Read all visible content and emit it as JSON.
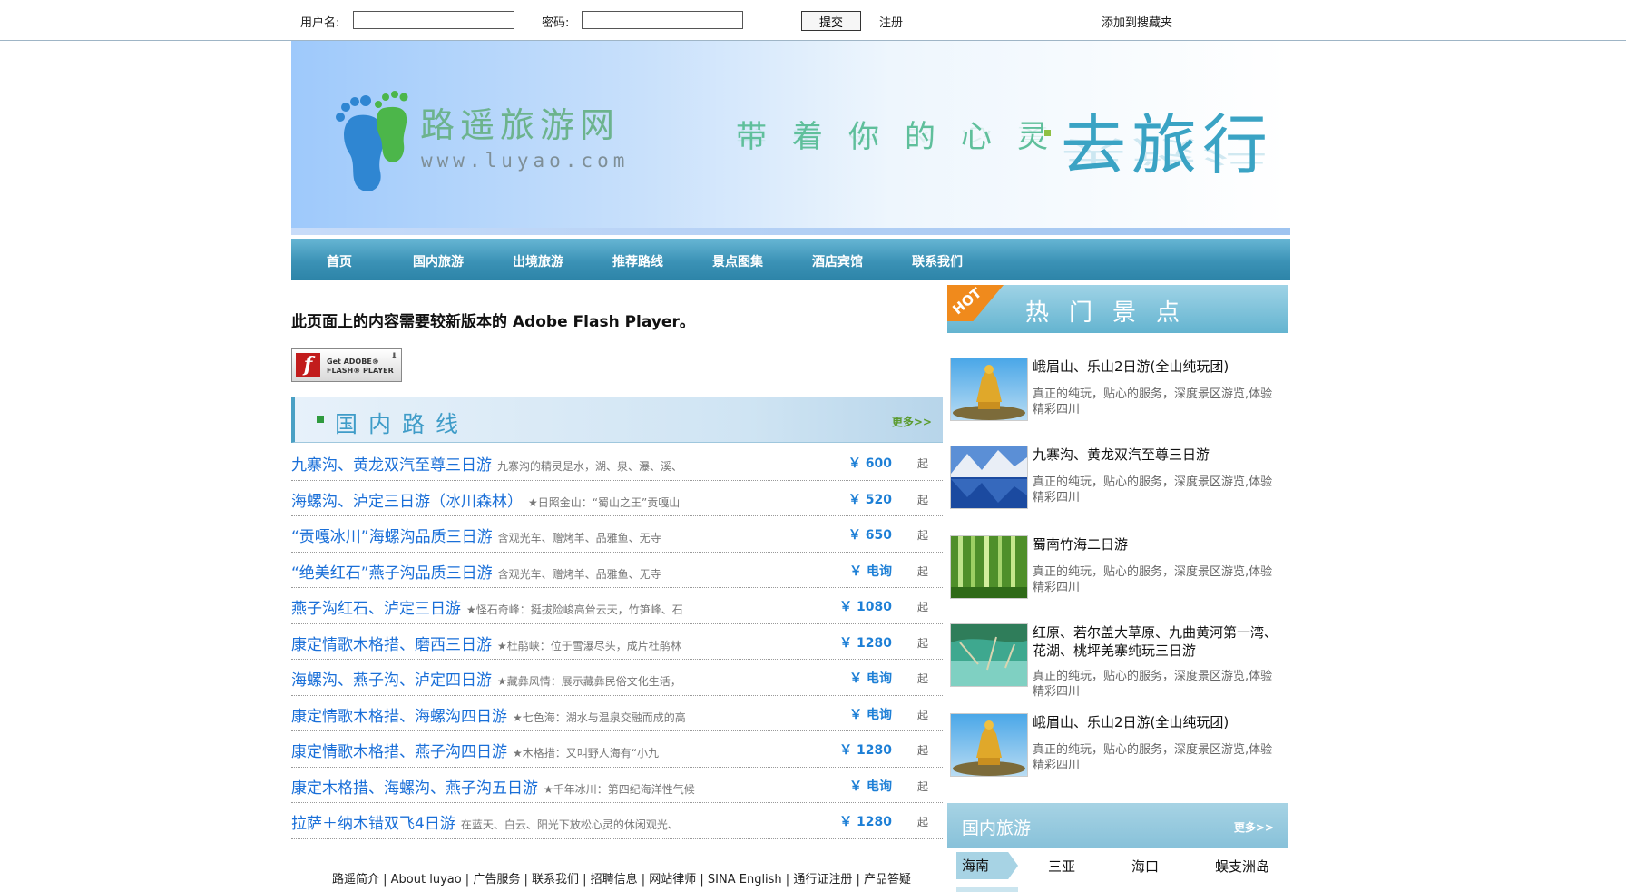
{
  "topbar": {
    "username_label": "用户名:",
    "username_value": "",
    "password_label": "密码:",
    "password_value": "",
    "submit_label": "提交",
    "register_label": "注册",
    "bookmark_label": "添加到搜藏夹"
  },
  "banner": {
    "logo_text": "路遥旅游网",
    "logo_url": "www.luyao.com",
    "slogan": "带着你的心灵",
    "slogan_big": "去旅行"
  },
  "nav": {
    "items": [
      "首页",
      "国内旅游",
      "出境旅游",
      "推荐路线",
      "景点图集",
      "酒店宾馆",
      "联系我们"
    ]
  },
  "flash": {
    "message": "此页面上的内容需要较新版本的 Adobe Flash Player。",
    "button_line1": "Get ADOBE®",
    "button_line2": "FLASH® PLAYER"
  },
  "routes_section": {
    "title": "国内路线",
    "more": "更多>>",
    "suffix": "起",
    "items": [
      {
        "name": "九寨沟、黄龙双汽至尊三日游",
        "desc": "九寨沟的精灵是水，湖、泉、瀑、溪、",
        "price": "￥ 600"
      },
      {
        "name": "海螺沟、泸定三日游（冰川森林）",
        "desc": "★日照金山：“蜀山之王”贡嘎山",
        "price": "￥ 520"
      },
      {
        "name": "“贡嘎冰川”海螺沟品质三日游",
        "desc": "含观光车、赠烤羊、品雅鱼、无寺",
        "price": "￥ 650"
      },
      {
        "name": "“绝美红石”燕子沟品质三日游",
        "desc": "含观光车、赠烤羊、品雅鱼、无寺",
        "price": "￥ 电询"
      },
      {
        "name": "燕子沟红石、泸定三日游",
        "desc": "★怪石奇峰：挺拔险峻高耸云天，竹笋峰、石",
        "price": "￥ 1080"
      },
      {
        "name": "康定情歌木格措、磨西三日游",
        "desc": "★杜鹃峡：位于雪瀑尽头，成片杜鹃林",
        "price": "￥ 1280"
      },
      {
        "name": "海螺沟、燕子沟、泸定四日游",
        "desc": "★藏彝风情：展示藏彝民俗文化生活，",
        "price": "￥ 电询"
      },
      {
        "name": "康定情歌木格措、海螺沟四日游",
        "desc": "★七色海：湖水与温泉交融而成的高",
        "price": "￥ 电询"
      },
      {
        "name": "康定情歌木格措、燕子沟四日游",
        "desc": "★木格措：又叫野人海有“小九",
        "price": "￥ 1280"
      },
      {
        "name": "康定木格措、海螺沟、燕子沟五日游",
        "desc": "★千年冰川：第四纪海洋性气候",
        "price": "￥ 电询"
      },
      {
        "name": "拉萨＋纳木错双飞4日游",
        "desc": "在蓝天、白云、阳光下放松心灵的休闲观光、",
        "price": "￥ 1280"
      }
    ]
  },
  "footer": {
    "links": "路遥简介 | About luyao | 广告服务 | 联系我们 | 招聘信息 | 网站律师 | SINA English | 通行证注册 | 产品答疑"
  },
  "hot_section": {
    "badge": "HOT",
    "title": "热门景点",
    "items": [
      {
        "title": "峨眉山、乐山2日游(全山纯玩团)",
        "desc": "真正的纯玩，贴心的服务，深度景区游览,体验精彩四川",
        "image": "golden-buddha-photo"
      },
      {
        "title": "九寨沟、黄龙双汽至尊三日游",
        "desc": "真正的纯玩，贴心的服务，深度景区游览,体验精彩四川",
        "image": "mountain-lake-photo"
      },
      {
        "title": "蜀南竹海二日游",
        "desc": "真正的纯玩，贴心的服务，深度景区游览,体验精彩四川",
        "image": "bamboo-forest-photo"
      },
      {
        "title": "红原、若尔盖大草原、九曲黄河第一湾、花湖、桃坪羌寨纯玩三日游",
        "desc": "真正的纯玩，贴心的服务，深度景区游览,体验精彩四川",
        "image": "green-lake-photo"
      },
      {
        "title": "峨眉山、乐山2日游(全山纯玩团)",
        "desc": "真正的纯玩，贴心的服务，深度景区游览,体验精彩四川",
        "image": "golden-buddha-photo"
      }
    ]
  },
  "domestic_section": {
    "title": "国内旅游",
    "more": "更多>>",
    "tabs": [
      "海南",
      "三亚",
      "海口",
      "蜈支洲岛"
    ]
  },
  "colors": {
    "nav": "#3b92b6",
    "link": "#1a6fd8",
    "price": "#1d7fd6",
    "logo_green": "#6cb38d",
    "hot_orange": "#f08a1c"
  }
}
